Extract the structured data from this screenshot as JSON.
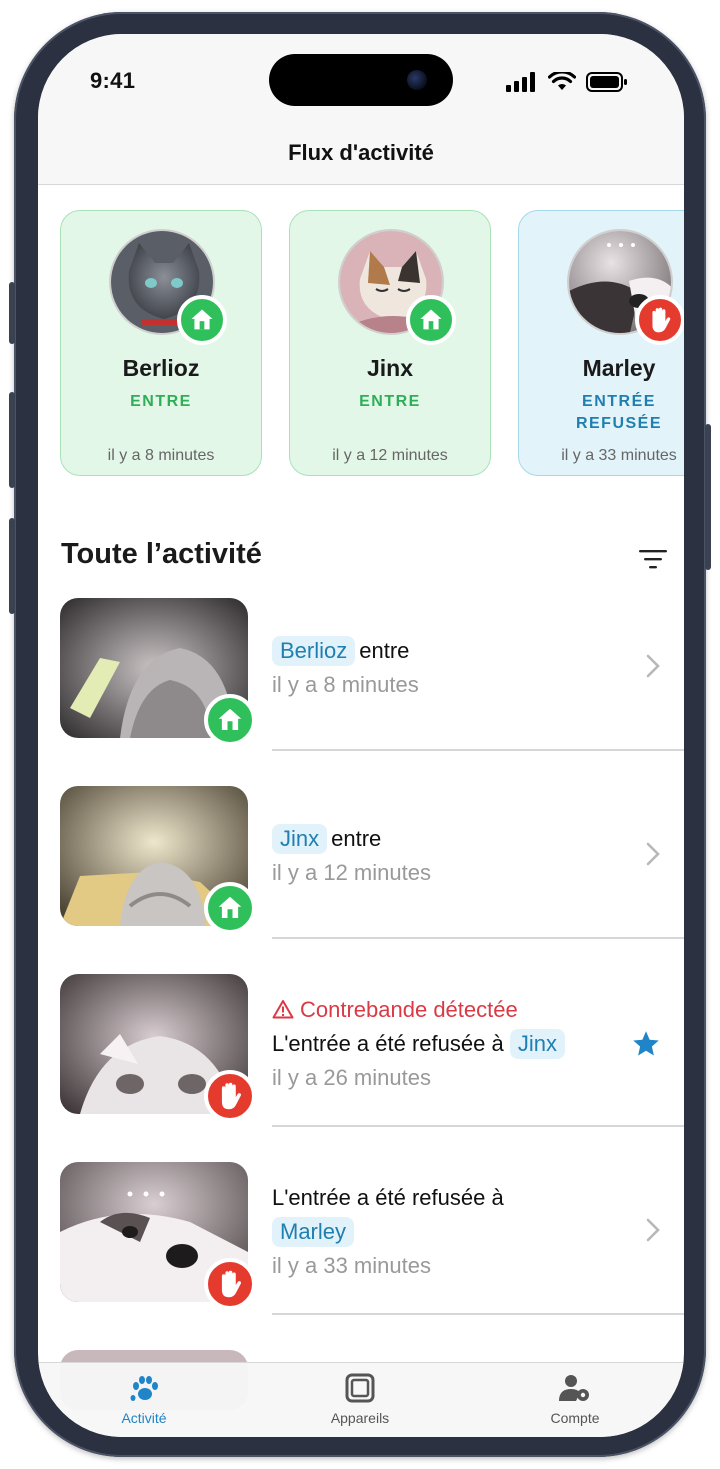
{
  "status_bar": {
    "time": "9:41"
  },
  "header": {
    "title": "Flux d'activité"
  },
  "colors": {
    "accent": "#1f7fb0",
    "success": "#2fbf5b",
    "danger": "#e53b2f",
    "alert_text": "#d93a46"
  },
  "summary_cards": [
    {
      "name": "Berlioz",
      "status": "ENTRE",
      "time": "il y a 8 minutes",
      "badge": "home-icon"
    },
    {
      "name": "Jinx",
      "status": "ENTRE",
      "time": "il y a 12 minutes",
      "badge": "home-icon"
    },
    {
      "name": "Marley",
      "status_line1": "ENTRÉE",
      "status_line2": "REFUSÉE",
      "time": "il y a 33 minutes",
      "badge": "hand-stop-icon"
    }
  ],
  "activity": {
    "title": "Toute l’activité",
    "items": [
      {
        "pet": "Berlioz",
        "action": "entre",
        "time": "il y a 8 minutes",
        "badge": "home-icon"
      },
      {
        "pet": "Jinx",
        "action": "entre",
        "time": "il y a 12 minutes",
        "badge": "home-icon"
      },
      {
        "alert": "Contrebande détectée",
        "action": "L'entrée a été refusée à",
        "pet": "Jinx",
        "time": "il y a 26 minutes",
        "badge": "hand-stop-icon",
        "starred": true
      },
      {
        "action": "L'entrée a été refusée à",
        "pet": "Marley",
        "time": "il y a 33 minutes",
        "badge": "hand-stop-icon"
      }
    ]
  },
  "tab_bar": {
    "tabs": [
      {
        "label": "Activité",
        "icon": "paw-icon",
        "active": true
      },
      {
        "label": "Appareils",
        "icon": "device-icon",
        "active": false
      },
      {
        "label": "Compte",
        "icon": "user-gear-icon",
        "active": false
      }
    ]
  }
}
